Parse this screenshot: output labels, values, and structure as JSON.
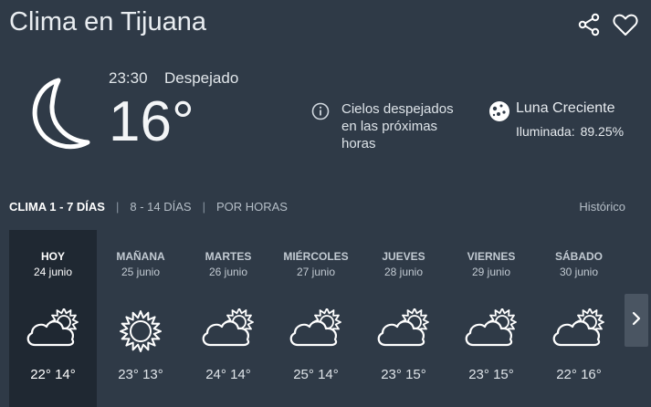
{
  "header": {
    "title": "Clima en Tijuana"
  },
  "icons": {
    "share": "share-icon",
    "favorite": "heart-icon"
  },
  "current": {
    "time": "23:30",
    "condition": "Despejado",
    "temperature": "16°",
    "icon": "crescent-moon-icon",
    "note": "Cielos despejados en las próximas horas"
  },
  "moon": {
    "phase": "Luna Creciente",
    "illum_label": "Iluminada:",
    "illum_value": "89.25%"
  },
  "tabs": {
    "t1": "CLIMA 1 - 7 DÍAS",
    "t2": "8 - 14 DÍAS",
    "t3": "POR HORAS",
    "sep": "|",
    "historico": "Histórico"
  },
  "days": [
    {
      "name": "HOY",
      "date": "24 junio",
      "temps": "22° 14°",
      "icon": "partly-cloudy-icon"
    },
    {
      "name": "MAÑANA",
      "date": "25 junio",
      "temps": "23° 13°",
      "icon": "sunny-icon"
    },
    {
      "name": "MARTES",
      "date": "26 junio",
      "temps": "24° 14°",
      "icon": "partly-cloudy-icon"
    },
    {
      "name": "MIÉRCOLES",
      "date": "27 junio",
      "temps": "25° 14°",
      "icon": "partly-cloudy-icon"
    },
    {
      "name": "JUEVES",
      "date": "28 junio",
      "temps": "23° 15°",
      "icon": "partly-cloudy-icon"
    },
    {
      "name": "VIERNES",
      "date": "29 junio",
      "temps": "23° 15°",
      "icon": "partly-cloudy-icon"
    },
    {
      "name": "SÁBADO",
      "date": "30 junio",
      "temps": "22° 16°",
      "icon": "partly-cloudy-icon"
    }
  ]
}
